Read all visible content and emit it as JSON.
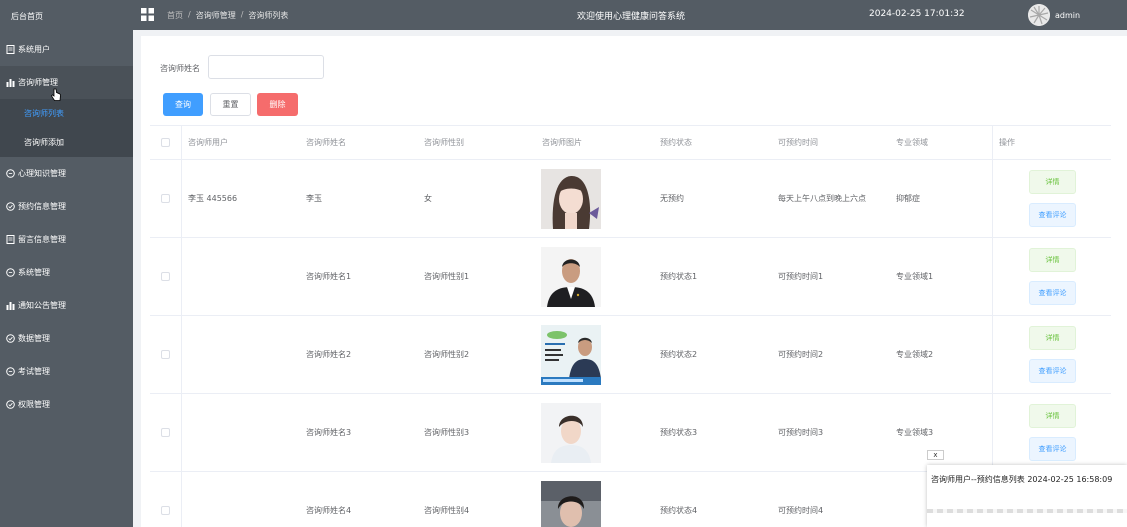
{
  "sidebar": {
    "home": "后台首页",
    "items": [
      {
        "label": "系统用户",
        "icon": "document-icon"
      },
      {
        "label": "咨询师管理",
        "icon": "bar-chart-icon"
      },
      {
        "label": "心理知识管理",
        "icon": "chat-icon"
      },
      {
        "label": "预约信息管理",
        "icon": "check-circle-icon"
      },
      {
        "label": "留言信息管理",
        "icon": "document-icon"
      },
      {
        "label": "系统管理",
        "icon": "chat-icon"
      },
      {
        "label": "通知公告管理",
        "icon": "bar-chart-icon"
      },
      {
        "label": "数据管理",
        "icon": "check-circle-icon"
      },
      {
        "label": "考试管理",
        "icon": "chat-icon"
      },
      {
        "label": "权限管理",
        "icon": "check-circle-icon"
      }
    ],
    "sub_items": [
      "咨询师列表",
      "咨询师添加"
    ]
  },
  "topbar": {
    "breadcrumb": [
      "首页",
      "咨询师管理",
      "咨询师列表"
    ],
    "breadcrumb_sep": "/",
    "title": "欢迎使用心理健康问答系统",
    "datetime": "2024-02-25 17:01:32",
    "username": "admin"
  },
  "search": {
    "label": "咨询师姓名",
    "value": "",
    "placeholder": ""
  },
  "buttons": {
    "query": "查询",
    "reset": "重置",
    "delete": "删除"
  },
  "table": {
    "headers": [
      "咨询师用户",
      "咨询师姓名",
      "咨询师性别",
      "咨询师图片",
      "预约状态",
      "可预约时间",
      "专业领域",
      "操作"
    ],
    "rows": [
      {
        "user": "李玉 445566",
        "name": "李玉",
        "gender": "女",
        "status": "无预约",
        "time": "每天上午八点到晚上六点",
        "field": "抑郁症"
      },
      {
        "user": "",
        "name": "咨询师姓名1",
        "gender": "咨询师性别1",
        "status": "预约状态1",
        "time": "可预约时间1",
        "field": "专业领域1"
      },
      {
        "user": "",
        "name": "咨询师姓名2",
        "gender": "咨询师性别2",
        "status": "预约状态2",
        "time": "可预约时间2",
        "field": "专业领域2"
      },
      {
        "user": "",
        "name": "咨询师姓名3",
        "gender": "咨询师性别3",
        "status": "预约状态3",
        "time": "可预约时间3",
        "field": "专业领域3"
      },
      {
        "user": "",
        "name": "咨询师姓名4",
        "gender": "咨询师性别4",
        "status": "预约状态4",
        "time": "可预约时间4",
        "field": ""
      }
    ],
    "op_detail": "详情",
    "op_review": "查看评论"
  },
  "notification": {
    "close": "x",
    "text": "咨询师用户--预约信息列表 2024-02-25 16:58:09"
  },
  "colors": {
    "sidebar_bg": "#545c64",
    "primary": "#409eff",
    "danger": "#f56c6c",
    "success": "#67c23a"
  }
}
